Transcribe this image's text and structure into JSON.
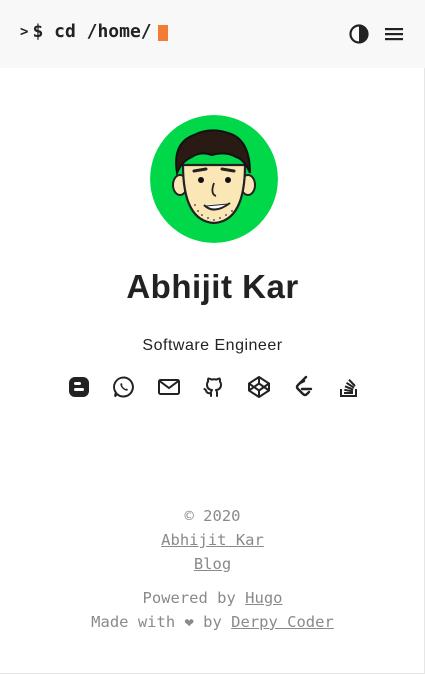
{
  "colors": {
    "accent": "#f27b36",
    "avatar_bg": "#00d84a",
    "text": "#222222",
    "muted": "#8a8a8a",
    "topbar_bg": "#f8f8f8"
  },
  "header": {
    "prompt_symbol": ">",
    "command": "$ cd /home/",
    "theme_toggle_icon": "contrast-icon",
    "menu_icon": "hamburger-menu-icon"
  },
  "profile": {
    "name": "Abhijit Kar",
    "role": "Software Engineer",
    "avatar_icon": "cartoon-avatar"
  },
  "socials": [
    {
      "icon": "blogger-icon"
    },
    {
      "icon": "whatsapp-icon"
    },
    {
      "icon": "mail-icon"
    },
    {
      "icon": "github-icon"
    },
    {
      "icon": "codepen-icon"
    },
    {
      "icon": "leetcode-icon"
    },
    {
      "icon": "stackoverflow-icon"
    }
  ],
  "footer": {
    "copyright": "© 2020",
    "author_link": "Abhijit Kar",
    "blog_link": "Blog",
    "powered_prefix": "Powered by ",
    "powered_link": "Hugo",
    "made_prefix": "Made with ❤ by ",
    "made_link": "Derpy Coder"
  }
}
